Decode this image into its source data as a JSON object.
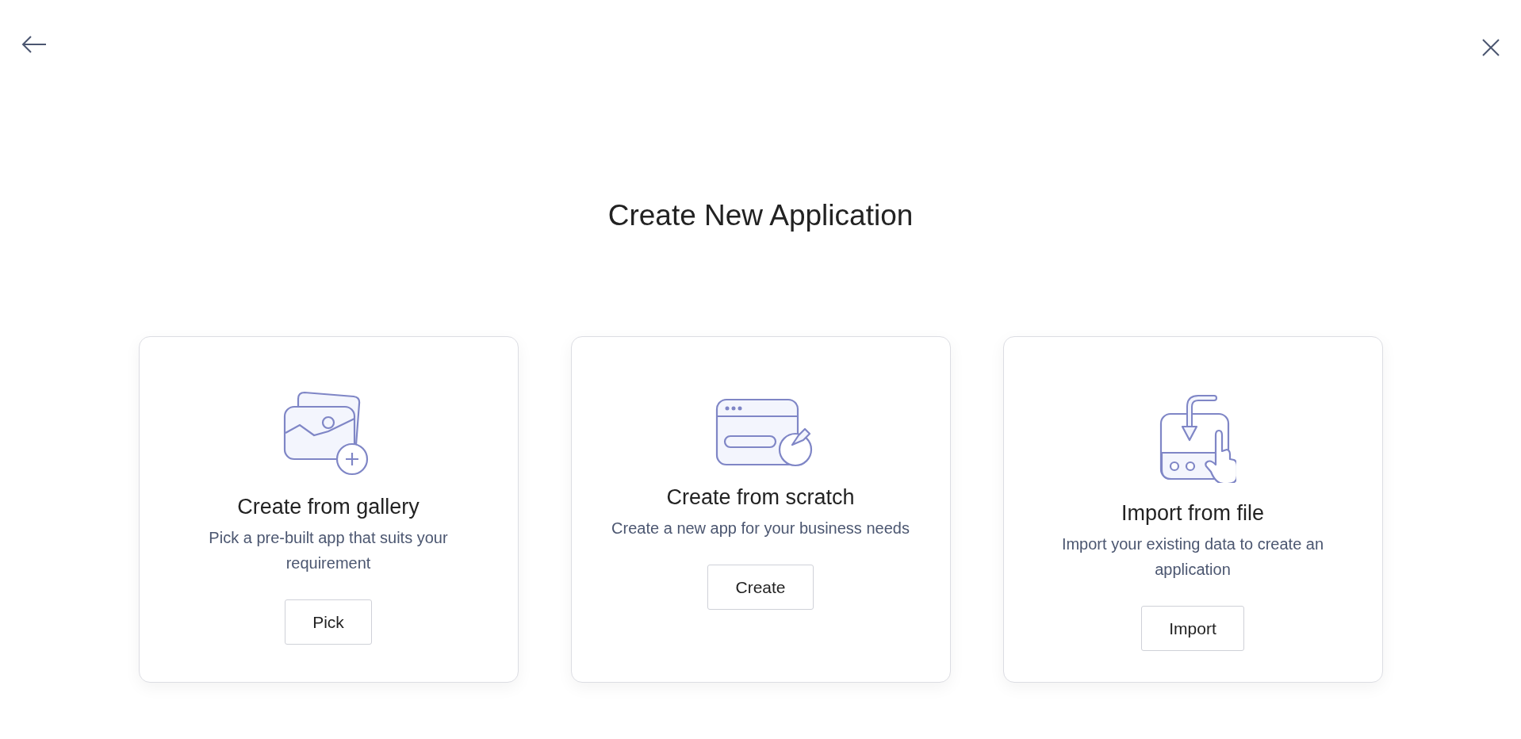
{
  "title": "Create New Application",
  "options": [
    {
      "kind": "gallery",
      "heading": "Create from gallery",
      "description": "Pick a pre-built app that suits your requirement",
      "button": "Pick"
    },
    {
      "kind": "scratch",
      "heading": "Create from scratch",
      "description": "Create a new app for your business needs",
      "button": "Create"
    },
    {
      "kind": "import",
      "heading": "Import from file",
      "description": "Import your existing data to create an application",
      "button": "Import"
    }
  ]
}
